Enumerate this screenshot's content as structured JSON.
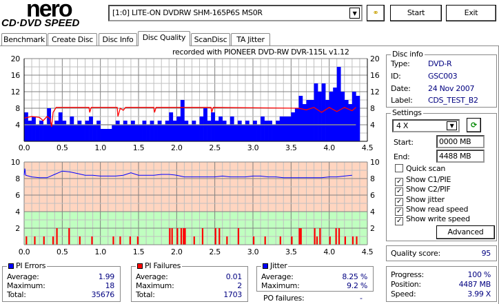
{
  "app": {
    "logo_top": "nero",
    "logo_bottom": "CD·DVD SPEED"
  },
  "toolbar": {
    "drive": "[1:0]  LITE-ON DVDRW SHM-165P6S MS0R",
    "start_label": "Start",
    "exit_label": "Exit",
    "config_icon": "chain-link-icon"
  },
  "tabs": [
    {
      "label": "Benchmark"
    },
    {
      "label": "Create Disc"
    },
    {
      "label": "Disc Info"
    },
    {
      "label": "Disc Quality",
      "active": true
    },
    {
      "label": "ScanDisc"
    },
    {
      "label": "TA Jitter"
    }
  ],
  "chart_caption": "recorded with PIONEER DVD-RW  DVR-115L v1.12",
  "disc_info": {
    "title": "Disc info",
    "type_label": "Type:",
    "type": "DVD-R",
    "id_label": "ID:",
    "id": "GSC003",
    "date_label": "Date:",
    "date": "24 Nov 2007",
    "label_label": "Label:",
    "label": "CDS_TEST_B2"
  },
  "settings": {
    "title": "Settings",
    "speed": "4 X",
    "start_label": "Start:",
    "start": "0000 MB",
    "end_label": "End:",
    "end": "4488 MB",
    "checks": [
      {
        "label": "Quick scan",
        "checked": false
      },
      {
        "label": "Show C1/PIE",
        "checked": true
      },
      {
        "label": "Show C2/PIF",
        "checked": true
      },
      {
        "label": "Show jitter",
        "checked": true
      },
      {
        "label": "Show read speed",
        "checked": true
      },
      {
        "label": "Show write speed",
        "checked": true
      }
    ],
    "advanced_label": "Advanced"
  },
  "quality": {
    "label": "Quality score:",
    "value": "95"
  },
  "progress": {
    "progress_label": "Progress:",
    "progress": "100 %",
    "position_label": "Position:",
    "position": "4487 MB",
    "speed_label": "Speed:",
    "speed": "3.99 X"
  },
  "pi_errors": {
    "title": "PI Errors",
    "color": "#0000ff",
    "average_label": "Average:",
    "average": "1.99",
    "maximum_label": "Maximum:",
    "maximum": "18",
    "total_label": "Total:",
    "total": "35676"
  },
  "pi_failures": {
    "title": "PI Failures",
    "color": "#ff0000",
    "average_label": "Average:",
    "average": "0.01",
    "maximum_label": "Maximum:",
    "maximum": "2",
    "total_label": "Total:",
    "total": "1703"
  },
  "jitter": {
    "title": "Jitter",
    "color": "#0000ff",
    "average_label": "Average:",
    "average": "8.25 %",
    "maximum_label": "Maximum:",
    "maximum": "9.2 %",
    "po_label": "PO failures:",
    "po": "-"
  },
  "chart_data": [
    {
      "type": "bar",
      "title": "PI Errors / Read speed",
      "xlim": [
        0,
        4.5
      ],
      "ylim": [
        0,
        20
      ],
      "xticks": [
        "0.0",
        "0.5",
        "1.0",
        "1.5",
        "2.0",
        "2.5",
        "3.0",
        "3.5",
        "4.0",
        "4.5"
      ],
      "yticks": [
        "4",
        "8",
        "12",
        "16",
        "20"
      ],
      "pie_step": 0.05,
      "pie": [
        7,
        5,
        6,
        4,
        5,
        4,
        8,
        4,
        5,
        7,
        5,
        4,
        6,
        4,
        5,
        4,
        5,
        6,
        4,
        5,
        3,
        3,
        3,
        4,
        5,
        4,
        5,
        4,
        5,
        4,
        4,
        5,
        4,
        5,
        4,
        5,
        4,
        5,
        7,
        5,
        6,
        10,
        5,
        4,
        5,
        4,
        6,
        8,
        5,
        7,
        5,
        6,
        5,
        4,
        6,
        4,
        5,
        4,
        5,
        4,
        5,
        4,
        6,
        5,
        5,
        4,
        5,
        6,
        6,
        6,
        7,
        8,
        11,
        9,
        10,
        10,
        14,
        12,
        14,
        10,
        12,
        13,
        18,
        12,
        10,
        9,
        12,
        11
      ],
      "read_speed": [
        [
          0,
          5.6
        ],
        [
          0.1,
          6
        ],
        [
          0.2,
          5.8
        ],
        [
          0.25,
          5
        ],
        [
          0.3,
          6
        ],
        [
          0.34,
          5.5
        ],
        [
          0.36,
          3.5
        ],
        [
          0.38,
          7
        ],
        [
          0.42,
          8.2
        ],
        [
          0.85,
          8.2
        ],
        [
          0.86,
          7
        ],
        [
          0.88,
          8.2
        ],
        [
          1.22,
          8.2
        ],
        [
          1.23,
          6
        ],
        [
          1.26,
          8
        ],
        [
          1.3,
          7.5
        ],
        [
          1.33,
          8.2
        ],
        [
          1.7,
          8.2
        ],
        [
          1.71,
          7
        ],
        [
          1.73,
          8.2
        ],
        [
          2.45,
          8.2
        ],
        [
          2.46,
          7
        ],
        [
          2.48,
          8.2
        ],
        [
          3.6,
          8
        ],
        [
          3.7,
          7.6
        ],
        [
          3.8,
          8.2
        ],
        [
          3.9,
          7
        ],
        [
          4.0,
          8.2
        ],
        [
          4.1,
          7.2
        ],
        [
          4.2,
          8.2
        ],
        [
          4.3,
          7.4
        ],
        [
          4.35,
          8.2
        ]
      ],
      "write_speed": [
        [
          0,
          4
        ],
        [
          4.35,
          4
        ]
      ]
    },
    {
      "type": "bar",
      "title": "Jitter / PI Failures",
      "xlim": [
        0,
        4.5
      ],
      "ylim": [
        0,
        10
      ],
      "xticks": [
        "0.0",
        "0.5",
        "1.0",
        "1.5",
        "2.0",
        "2.5",
        "3.0",
        "3.5",
        "4.0",
        "4.5"
      ],
      "yticks": [
        "2",
        "4",
        "6",
        "8",
        "10"
      ],
      "jitter_step": 0.1,
      "jitter": [
        8.4,
        8.2,
        8.1,
        8.1,
        8.5,
        8.9,
        8.8,
        8.6,
        8.4,
        8.4,
        8.3,
        8.3,
        8.3,
        8.4,
        8.7,
        8.4,
        8.4,
        8.4,
        8.5,
        8.5,
        8.4,
        8.2,
        8.2,
        8.2,
        8.2,
        8.2,
        8.3,
        8.2,
        8.2,
        8.2,
        8.3,
        8.3,
        8.2,
        8.2,
        8.1,
        8.1,
        8.1,
        8.1,
        8.1,
        8.1,
        8.2,
        8.2,
        8.3,
        8.4
      ],
      "pif": [
        [
          0.02,
          1
        ],
        [
          0.13,
          1
        ],
        [
          0.25,
          1
        ],
        [
          0.37,
          1
        ],
        [
          0.42,
          2
        ],
        [
          0.58,
          2
        ],
        [
          0.72,
          1
        ],
        [
          0.88,
          1
        ],
        [
          1.16,
          1
        ],
        [
          1.25,
          1
        ],
        [
          1.38,
          1
        ],
        [
          1.48,
          1
        ],
        [
          1.9,
          2
        ],
        [
          1.93,
          2
        ],
        [
          2.0,
          2
        ],
        [
          2.05,
          2
        ],
        [
          2.08,
          2
        ],
        [
          2.1,
          2
        ],
        [
          2.22,
          1
        ],
        [
          2.33,
          2
        ],
        [
          2.5,
          2
        ],
        [
          2.55,
          2
        ],
        [
          2.65,
          1
        ],
        [
          2.8,
          2
        ],
        [
          3.0,
          1
        ],
        [
          3.15,
          1
        ],
        [
          3.35,
          1
        ],
        [
          3.5,
          1
        ],
        [
          3.6,
          2
        ],
        [
          3.62,
          2
        ],
        [
          3.8,
          2
        ],
        [
          3.83,
          1
        ],
        [
          3.87,
          2
        ],
        [
          4.0,
          1
        ],
        [
          4.08,
          2
        ],
        [
          4.12,
          2
        ],
        [
          4.2,
          1
        ],
        [
          4.3,
          1
        ],
        [
          4.35,
          1
        ]
      ]
    }
  ]
}
